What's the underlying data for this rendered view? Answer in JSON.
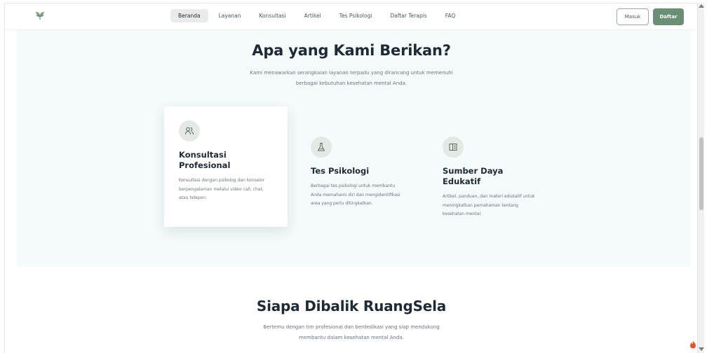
{
  "nav": {
    "items": [
      {
        "label": "Beranda",
        "active": true
      },
      {
        "label": "Layanan",
        "active": false
      },
      {
        "label": "Konsultasi",
        "active": false
      },
      {
        "label": "Artikel",
        "active": false
      },
      {
        "label": "Tes Psikologi",
        "active": false
      },
      {
        "label": "Daftar Terapis",
        "active": false
      },
      {
        "label": "FAQ",
        "active": false
      }
    ],
    "login_label": "Masuk",
    "register_label": "Daftar"
  },
  "services": {
    "title": "Apa yang Kami Berikan?",
    "description_line1": "Kami menawarkan serangkaian layanan terpadu yang dirancang untuk memenuhi",
    "description_line2": "berbagai kebutuhan kesehatan mental Anda.",
    "cards": [
      {
        "icon": "users-icon",
        "title": "Konsultasi Profesional",
        "text": "Konsultasi dengan psikolog dan konselor berpengalaman melalui video call, chat, atau telepon."
      },
      {
        "icon": "flask-icon",
        "title": "Tes Psikologi",
        "text": "Berbagai tes psikologi untuk membantu Anda memahami diri dan mengidentifikasi area yang perlu ditingkatkan."
      },
      {
        "icon": "book-icon",
        "title": "Sumber Daya Edukatif",
        "text": "Artikel, panduan, dan materi edukatif untuk meningkatkan pemahaman tentang kesehatan mental."
      }
    ]
  },
  "team": {
    "title": "Siapa Dibalik RuangSela",
    "description_line1": "Bertemu dengan tim profesional dan berdedikasi yang siap mendukung",
    "description_line2": "membantu dalam kesehatan mental Anda."
  },
  "colors": {
    "accent": "#6b8f74",
    "section_bg": "#f4fbfa",
    "heading": "#1f2a37"
  }
}
